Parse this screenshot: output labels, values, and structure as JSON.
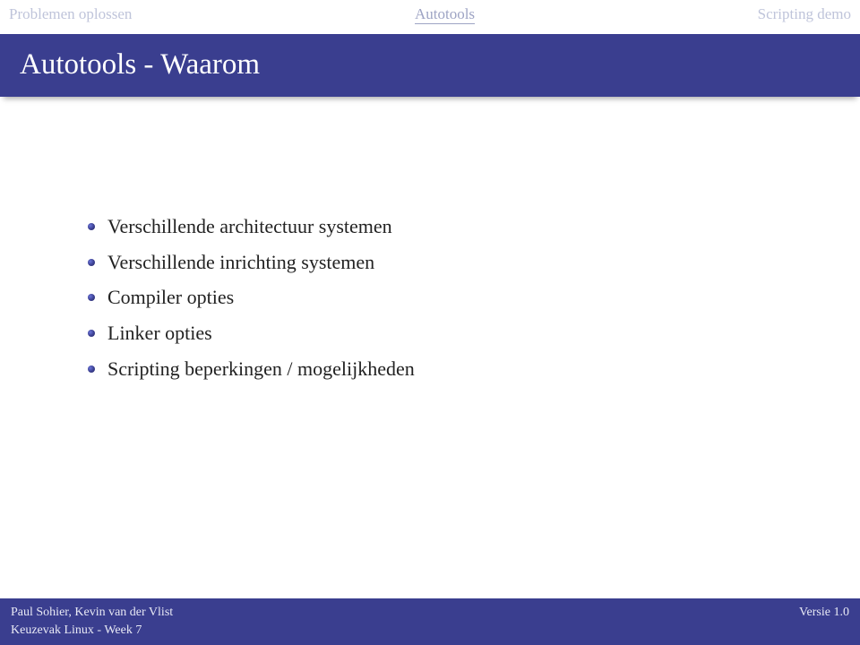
{
  "nav": {
    "left": "Problemen oplossen",
    "center": "Autotools",
    "right": "Scripting demo"
  },
  "title": "Autotools - Waarom",
  "bullets": [
    "Verschillende architectuur systemen",
    "Verschillende inrichting systemen",
    "Compiler opties",
    "Linker opties",
    "Scripting beperkingen / mogelijkheden"
  ],
  "footer": {
    "author": "Paul Sohier, Kevin van der Vlist",
    "version": "Versie 1.0",
    "course": "Keuzevak Linux - Week 7"
  }
}
